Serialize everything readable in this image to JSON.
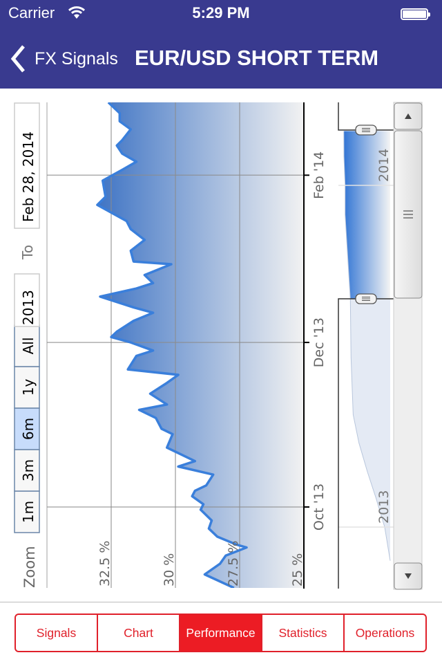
{
  "status_bar": {
    "carrier": "Carrier",
    "time": "5:29 PM",
    "wifi_icon": "wifi-icon",
    "battery_icon": "battery-icon"
  },
  "nav": {
    "back_label": "FX Signals",
    "title": "EUR/USD SHORT TERM",
    "back_icon": "chevron-left-icon"
  },
  "range_selector": {
    "zoom_label": "Zoom",
    "buttons": [
      {
        "label": "1m",
        "selected": false
      },
      {
        "label": "3m",
        "selected": false
      },
      {
        "label": "6m",
        "selected": true
      },
      {
        "label": "1y",
        "selected": false
      },
      {
        "label": "All",
        "selected": false
      }
    ],
    "from_value": "2013",
    "to_label": "To",
    "to_value": "Feb 28, 2014"
  },
  "chart_data": {
    "type": "area",
    "orientation": "rotated",
    "x_range": [
      "2013-09-01",
      "2014-02-28"
    ],
    "ylim": [
      25,
      35
    ],
    "y_ticks": [
      "25 %",
      "27.5 %",
      "30 %",
      "32.5 %"
    ],
    "y_tick_values": [
      25,
      27.5,
      30,
      32.5
    ],
    "x_ticks": [
      "Oct '13",
      "Dec '13",
      "Feb '14"
    ],
    "x_tick_dates": [
      "2013-10-01",
      "2013-12-01",
      "2014-02-01"
    ],
    "grid": true,
    "colors": {
      "line": "#3a7fdb",
      "fill_top": "#3f74c4",
      "fill_bottom": "#f2f2f2"
    },
    "series": [
      {
        "points": [
          [
            "2013-09-01",
            27.72
          ],
          [
            "2013-09-06",
            28.86
          ],
          [
            "2013-09-10",
            28.26
          ],
          [
            "2013-09-13",
            28.04
          ],
          [
            "2013-09-16",
            27.23
          ],
          [
            "2013-09-17",
            27.61
          ],
          [
            "2013-09-20",
            28.37
          ],
          [
            "2013-09-23",
            28.7
          ],
          [
            "2013-09-26",
            28.59
          ],
          [
            "2013-09-30",
            29.02
          ],
          [
            "2013-10-02",
            28.91
          ],
          [
            "2013-10-05",
            29.35
          ],
          [
            "2013-10-07",
            29.24
          ],
          [
            "2013-10-09",
            28.8
          ],
          [
            "2013-10-13",
            28.53
          ],
          [
            "2013-10-16",
            29.89
          ],
          [
            "2013-10-18",
            29.24
          ],
          [
            "2013-10-23",
            30.33
          ],
          [
            "2013-10-28",
            30.11
          ],
          [
            "2013-10-30",
            30.54
          ],
          [
            "2013-11-03",
            30.76
          ],
          [
            "2013-11-06",
            31.41
          ],
          [
            "2013-11-08",
            30.33
          ],
          [
            "2013-11-12",
            30.98
          ],
          [
            "2013-11-16",
            30.33
          ],
          [
            "2013-11-19",
            29.89
          ],
          [
            "2013-11-21",
            31.85
          ],
          [
            "2013-11-26",
            31.52
          ],
          [
            "2013-11-28",
            30.87
          ],
          [
            "2013-12-01",
            31.74
          ],
          [
            "2013-12-03",
            32.5
          ],
          [
            "2013-12-05",
            32.28
          ],
          [
            "2013-12-09",
            31.63
          ],
          [
            "2013-12-12",
            30.87
          ],
          [
            "2013-12-14",
            31.63
          ],
          [
            "2013-12-18",
            32.93
          ],
          [
            "2013-12-21",
            31.52
          ],
          [
            "2013-12-23",
            30.87
          ],
          [
            "2013-12-26",
            31.2
          ],
          [
            "2013-12-30",
            30.16
          ],
          [
            "2013-12-31",
            31.63
          ],
          [
            "2014-01-04",
            31.74
          ],
          [
            "2014-01-08",
            31.2
          ],
          [
            "2014-01-12",
            31.74
          ],
          [
            "2014-01-15",
            31.9
          ],
          [
            "2014-01-21",
            33.04
          ],
          [
            "2014-01-24",
            32.72
          ],
          [
            "2014-01-30",
            32.83
          ],
          [
            "2014-02-03",
            32.07
          ],
          [
            "2014-02-06",
            31.52
          ],
          [
            "2014-02-09",
            32.07
          ],
          [
            "2014-02-12",
            32.28
          ],
          [
            "2014-02-14",
            32.07
          ],
          [
            "2014-02-18",
            31.74
          ],
          [
            "2014-02-21",
            32.17
          ],
          [
            "2014-02-24",
            32.17
          ],
          [
            "2014-02-28",
            32.61
          ]
        ]
      }
    ],
    "navigator": {
      "x_ticks": [
        "2013",
        "2014"
      ],
      "selected_range": [
        "2013-09-01",
        "2014-02-28"
      ],
      "points": [
        [
          "2012-11-26",
          0
        ],
        [
          "2013-01-01",
          3.9
        ],
        [
          "2013-02-01",
          10
        ],
        [
          "2013-03-01",
          16
        ],
        [
          "2013-04-01",
          22
        ],
        [
          "2013-05-01",
          26
        ],
        [
          "2013-07-01",
          27.5
        ],
        [
          "2013-09-01",
          28
        ],
        [
          "2013-11-01",
          30.5
        ],
        [
          "2013-12-01",
          31.7
        ],
        [
          "2014-01-01",
          31.7
        ],
        [
          "2014-02-01",
          32.5
        ],
        [
          "2014-02-28",
          32.6
        ]
      ]
    }
  },
  "tabs": [
    {
      "label": "Signals",
      "active": false
    },
    {
      "label": "Chart",
      "active": false
    },
    {
      "label": "Performance",
      "active": true
    },
    {
      "label": "Statistics",
      "active": false
    },
    {
      "label": "Operations",
      "active": false
    }
  ]
}
